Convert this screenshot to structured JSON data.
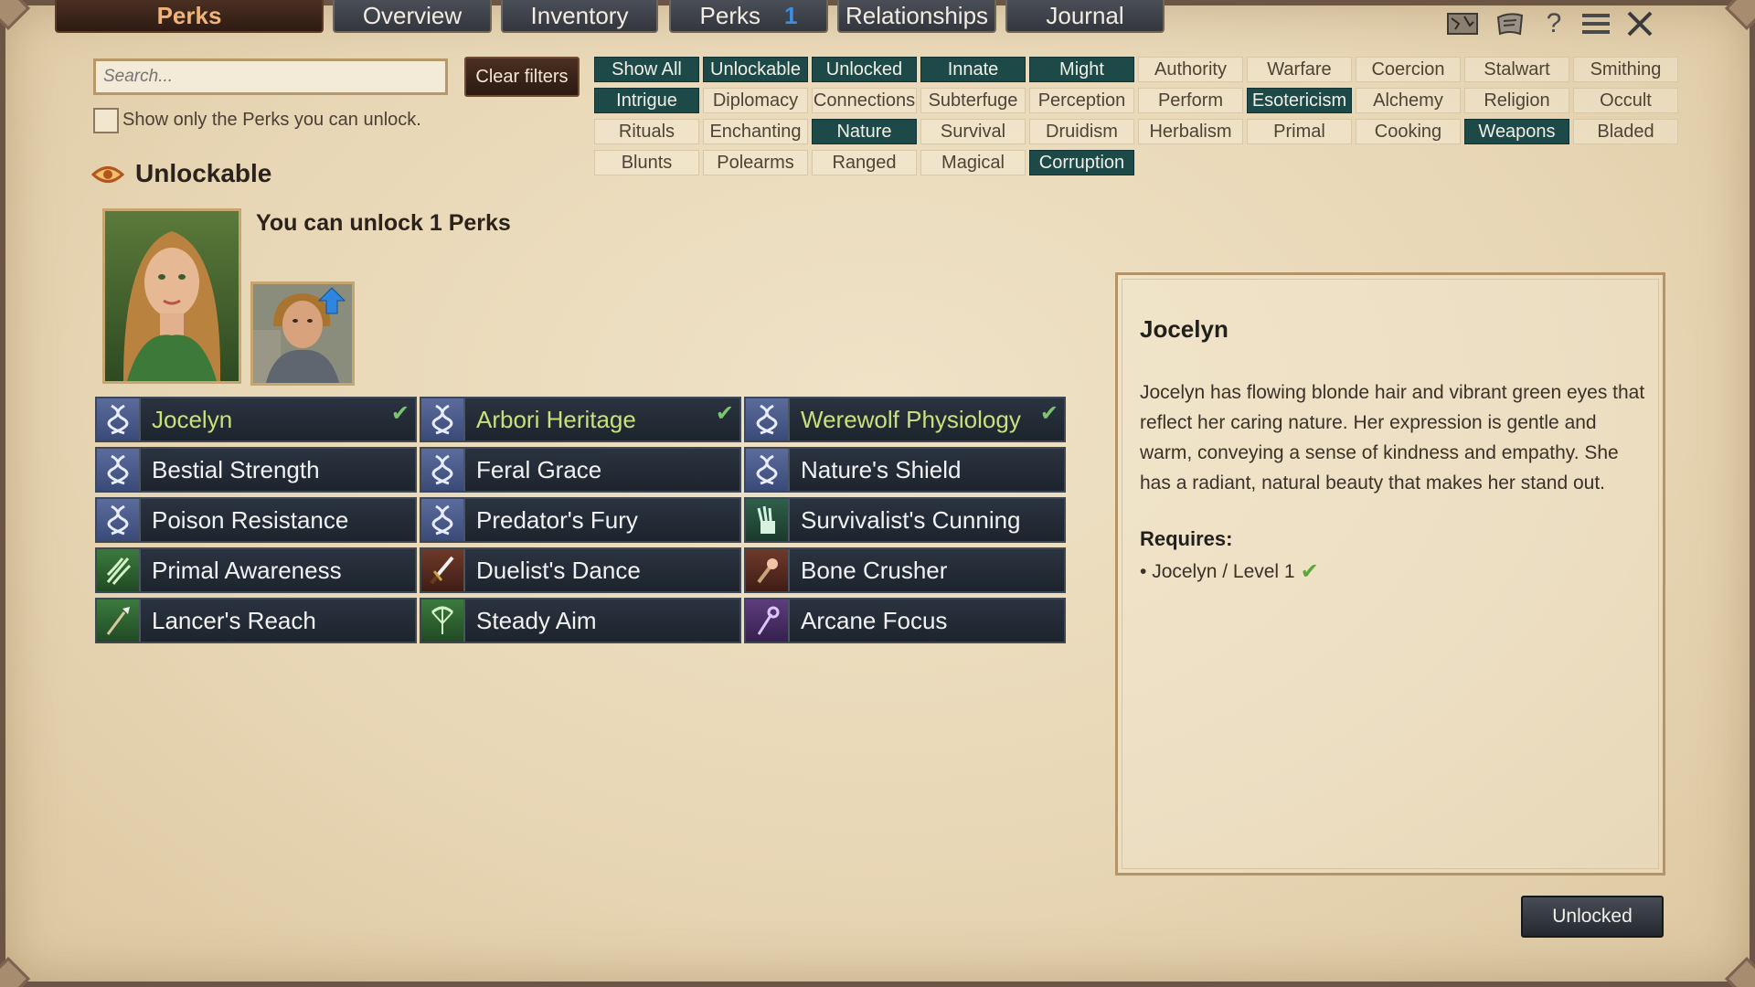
{
  "tabs": {
    "title": "Perks",
    "items": [
      {
        "label": "Overview"
      },
      {
        "label": "Inventory"
      },
      {
        "label": "Perks",
        "badge": "1"
      },
      {
        "label": "Relationships"
      },
      {
        "label": "Journal"
      }
    ]
  },
  "top_icons": [
    "map-icon",
    "scroll-icon",
    "help-icon",
    "menu-icon",
    "close-icon"
  ],
  "search": {
    "placeholder": "Search...",
    "value": ""
  },
  "clear_filters_label": "Clear filters",
  "only_unlockable": {
    "label": "Show only the Perks you can unlock.",
    "checked": false
  },
  "filters": [
    {
      "label": "Show All",
      "active": true
    },
    {
      "label": "Unlockable",
      "active": true
    },
    {
      "label": "Unlocked",
      "active": true
    },
    {
      "label": "Innate",
      "active": true
    },
    {
      "label": "Might",
      "active": true
    },
    {
      "label": "Authority",
      "active": false
    },
    {
      "label": "Warfare",
      "active": false
    },
    {
      "label": "Coercion",
      "active": false
    },
    {
      "label": "Stalwart",
      "active": false
    },
    {
      "label": "Smithing",
      "active": false
    },
    {
      "label": "Intrigue",
      "active": true
    },
    {
      "label": "Diplomacy",
      "active": false
    },
    {
      "label": "Connections",
      "active": false
    },
    {
      "label": "Subterfuge",
      "active": false
    },
    {
      "label": "Perception",
      "active": false
    },
    {
      "label": "Perform",
      "active": false
    },
    {
      "label": "Esotericism",
      "active": true
    },
    {
      "label": "Alchemy",
      "active": false
    },
    {
      "label": "Religion",
      "active": false
    },
    {
      "label": "Occult",
      "active": false
    },
    {
      "label": "Rituals",
      "active": false
    },
    {
      "label": "Enchanting",
      "active": false
    },
    {
      "label": "Nature",
      "active": true
    },
    {
      "label": "Survival",
      "active": false
    },
    {
      "label": "Druidism",
      "active": false
    },
    {
      "label": "Herbalism",
      "active": false
    },
    {
      "label": "Primal",
      "active": false
    },
    {
      "label": "Cooking",
      "active": false
    },
    {
      "label": "Weapons",
      "active": true
    },
    {
      "label": "Bladed",
      "active": false
    },
    {
      "label": "Blunts",
      "active": false
    },
    {
      "label": "Polearms",
      "active": false
    },
    {
      "label": "Ranged",
      "active": false
    },
    {
      "label": "Magical",
      "active": false
    },
    {
      "label": "Corruption",
      "active": true
    }
  ],
  "section": {
    "title": "Unlockable"
  },
  "unlock_summary": "You can unlock 1 Perks",
  "perks": [
    {
      "name": "Jocelyn",
      "icon": "dna-icon",
      "style": "dna",
      "unlocked": true
    },
    {
      "name": "Arbori Heritage",
      "icon": "dna-icon",
      "style": "dna",
      "unlocked": true
    },
    {
      "name": "Werewolf Physiology",
      "icon": "dna-icon",
      "style": "dna",
      "unlocked": true
    },
    {
      "name": "Bestial Strength",
      "icon": "dna-icon",
      "style": "dna",
      "unlocked": false
    },
    {
      "name": "Feral Grace",
      "icon": "dna-icon",
      "style": "dna",
      "unlocked": false
    },
    {
      "name": "Nature's Shield",
      "icon": "dna-icon",
      "style": "dna",
      "unlocked": false
    },
    {
      "name": "Poison Resistance",
      "icon": "dna-icon",
      "style": "dna",
      "unlocked": false
    },
    {
      "name": "Predator's Fury",
      "icon": "dna-icon",
      "style": "dna",
      "unlocked": false
    },
    {
      "name": "Survivalist's Cunning",
      "icon": "quiver-icon",
      "style": "teal",
      "unlocked": false
    },
    {
      "name": "Primal Awareness",
      "icon": "claw-marks-icon",
      "style": "green",
      "unlocked": false
    },
    {
      "name": "Duelist's Dance",
      "icon": "sword-icon",
      "style": "red",
      "unlocked": false
    },
    {
      "name": "Bone Crusher",
      "icon": "mace-icon",
      "style": "red",
      "unlocked": false
    },
    {
      "name": "Lancer's Reach",
      "icon": "spear-icon",
      "style": "green",
      "unlocked": false
    },
    {
      "name": "Steady Aim",
      "icon": "bow-icon",
      "style": "green",
      "unlocked": false
    },
    {
      "name": "Arcane Focus",
      "icon": "staff-icon",
      "style": "purple",
      "unlocked": false
    }
  ],
  "detail": {
    "title": "Jocelyn",
    "description": "Jocelyn has flowing blonde hair and vibrant green eyes that reflect her caring nature. Her expression is gentle and warm, conveying a sense of kindness and empathy. She has a radiant, natural beauty that makes her stand out.",
    "requires_label": "Requires:",
    "requirements": [
      "Jocelyn / Level 1"
    ]
  },
  "unlocked_button_label": "Unlocked",
  "colors": {
    "filter_active": "#1d4a48",
    "perk_unlocked_text": "#c7e27b",
    "title_tab_text": "#f0b37a",
    "badge": "#3d8de0"
  }
}
